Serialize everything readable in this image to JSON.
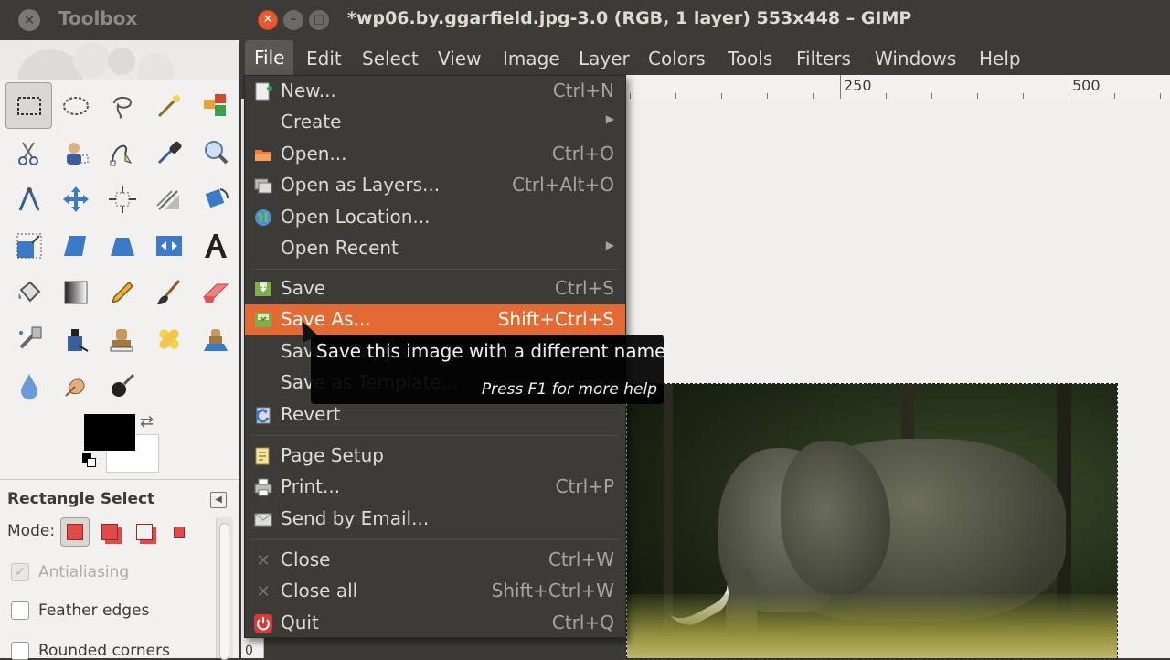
{
  "toolbox": {
    "title": "Toolbox",
    "tools": [
      "rect-select",
      "ellipse-select",
      "free-select",
      "fuzzy-select",
      "select-by-color",
      "scissors-select",
      "foreground-select",
      "paths",
      "color-picker",
      "zoom",
      "measure",
      "move",
      "align",
      "crop",
      "rotate",
      "scale",
      "shear",
      "perspective",
      "flip",
      "text",
      "bucket-fill",
      "blend",
      "pencil",
      "paintbrush",
      "eraser",
      "airbrush",
      "ink",
      "clone",
      "heal",
      "perspective-clone",
      "blur",
      "smudge",
      "dodge-burn"
    ],
    "tool_options": {
      "title": "Rectangle Select",
      "mode_label": "Mode:",
      "antialiasing": "Antialiasing",
      "feather_edges": "Feather edges",
      "rounded_corners": "Rounded corners"
    },
    "fg_color": "#000000",
    "bg_color": "#ffffff"
  },
  "image_window": {
    "title": "*wp06.by.ggarfield.jpg-3.0 (RGB, 1 layer) 553x448 – GIMP",
    "menus": [
      "File",
      "Edit",
      "Select",
      "View",
      "Image",
      "Layer",
      "Colors",
      "Tools",
      "Filters",
      "Windows",
      "Help"
    ],
    "ruler": {
      "top_labels": [
        "250",
        "500"
      ],
      "left_label": "0"
    }
  },
  "file_menu": {
    "items": [
      {
        "label": "New...",
        "shortcut": "Ctrl+N",
        "icon": "new-icon"
      },
      {
        "label": "Create",
        "shortcut": "",
        "icon": "",
        "submenu": true
      },
      {
        "label": "Open...",
        "shortcut": "Ctrl+O",
        "icon": "open-icon"
      },
      {
        "label": "Open as Layers...",
        "shortcut": "Ctrl+Alt+O",
        "icon": "open-layers-icon"
      },
      {
        "label": "Open Location...",
        "shortcut": "",
        "icon": "globe-icon"
      },
      {
        "label": "Open Recent",
        "shortcut": "",
        "icon": "",
        "submenu": true
      },
      {
        "label": "Save",
        "shortcut": "Ctrl+S",
        "icon": "save-icon"
      },
      {
        "label": "Save As...",
        "shortcut": "Shift+Ctrl+S",
        "icon": "save-as-icon"
      },
      {
        "label": "Save a Copy...",
        "shortcut": "",
        "icon": ""
      },
      {
        "label": "Save as Template...",
        "shortcut": "",
        "icon": ""
      },
      {
        "label": "Revert",
        "shortcut": "",
        "icon": "revert-icon"
      },
      {
        "label": "Page Setup",
        "shortcut": "",
        "icon": "page-setup-icon"
      },
      {
        "label": "Print...",
        "shortcut": "Ctrl+P",
        "icon": "print-icon"
      },
      {
        "label": "Send by Email...",
        "shortcut": "",
        "icon": "email-icon"
      },
      {
        "label": "Close",
        "shortcut": "Ctrl+W",
        "icon": "close-icon"
      },
      {
        "label": "Close all",
        "shortcut": "Shift+Ctrl+W",
        "icon": "close-all-icon"
      },
      {
        "label": "Quit",
        "shortcut": "Ctrl+Q",
        "icon": "quit-icon"
      }
    ]
  },
  "tooltip": {
    "text": "Save this image with a different name",
    "help": "Press F1 for more help"
  },
  "colors": {
    "highlight": "#e46a34",
    "menu_bg": "#3c3b37",
    "menu_text": "#dfdbd2"
  }
}
